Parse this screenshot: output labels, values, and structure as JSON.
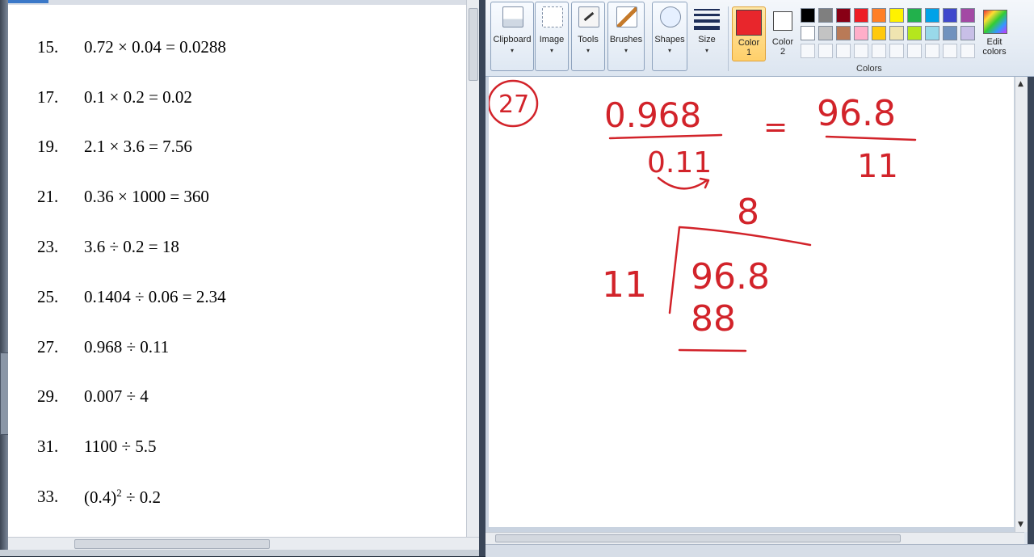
{
  "document": {
    "problems": [
      {
        "num": "15.",
        "expr": "0.72 × 0.04 = 0.0288"
      },
      {
        "num": "17.",
        "expr": "0.1 × 0.2 = 0.02"
      },
      {
        "num": "19.",
        "expr": "2.1 × 3.6 = 7.56"
      },
      {
        "num": "21.",
        "expr": "0.36 × 1000 = 360"
      },
      {
        "num": "23.",
        "expr": "3.6 ÷ 0.2 = 18"
      },
      {
        "num": "25.",
        "expr": "0.1404 ÷ 0.06 = 2.34"
      },
      {
        "num": "27.",
        "expr": "0.968 ÷ 0.11"
      },
      {
        "num": "29.",
        "expr": "0.007 ÷ 4"
      },
      {
        "num": "31.",
        "expr": "1100 ÷ 5.5"
      },
      {
        "num": "33.",
        "expr_base": "(0.4)",
        "expr_sup": "2",
        "expr_rest": " ÷ 0.2"
      }
    ]
  },
  "paint": {
    "tools": {
      "clipboard": "Clipboard",
      "image": "Image",
      "tools": "Tools",
      "brushes": "Brushes",
      "shapes": "Shapes",
      "size": "Size"
    },
    "color1_label": "Color\n1",
    "color2_label": "Color\n2",
    "colors_group_label": "Colors",
    "edit_colors_label": "Edit\ncolors",
    "color1_value": "#e8262c",
    "color2_value": "#ffffff",
    "palette_row1": [
      "#000000",
      "#7f7f7f",
      "#880015",
      "#ed1c24",
      "#ff7f27",
      "#fff200",
      "#22b14c",
      "#00a2e8",
      "#3f48cc",
      "#a349a4"
    ],
    "palette_row2": [
      "#ffffff",
      "#c3c3c3",
      "#b97a57",
      "#ffaec9",
      "#ffc90e",
      "#efe4b0",
      "#b5e61d",
      "#99d9ea",
      "#7092be",
      "#c8bfe7"
    ],
    "drawing": {
      "problem_circle": "27",
      "numerator": "0.968",
      "denominator": "0.11",
      "equals": "=",
      "new_numerator": "96.8",
      "new_denominator": "11",
      "quotient_digit": "8",
      "divisor": "11",
      "dividend": "96.8",
      "product": "88",
      "ink_color": "#d2232a"
    }
  }
}
